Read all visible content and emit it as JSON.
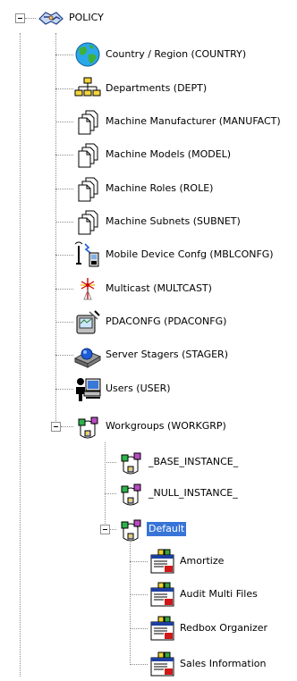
{
  "tree": {
    "root": {
      "label": "POLICY",
      "icon": "handshake-icon",
      "expanded": true
    },
    "items": [
      {
        "label": "Country / Region (COUNTRY)",
        "icon": "globe-icon"
      },
      {
        "label": "Departments (DEPT)",
        "icon": "org-chart-icon"
      },
      {
        "label": "Machine Manufacturer (MANUFACT)",
        "icon": "documents-icon"
      },
      {
        "label": "Machine Models (MODEL)",
        "icon": "documents-icon"
      },
      {
        "label": "Machine Roles (ROLE)",
        "icon": "documents-icon"
      },
      {
        "label": "Machine Subnets (SUBNET)",
        "icon": "documents-icon"
      },
      {
        "label": "Mobile Device Confg (MBLCONFG)",
        "icon": "mobile-device-icon"
      },
      {
        "label": "Multicast (MULTCAST)",
        "icon": "multicast-icon"
      },
      {
        "label": "PDACONFG (PDACONFG)",
        "icon": "pda-icon"
      },
      {
        "label": "Server Stagers (STAGER)",
        "icon": "server-stager-icon"
      },
      {
        "label": "Users (USER)",
        "icon": "user-computer-icon"
      },
      {
        "label": "Workgroups (WORKGRP)",
        "icon": "workgroup-icon",
        "expanded": true
      }
    ],
    "workgroups": [
      {
        "label": "_BASE_INSTANCE_",
        "icon": "workgroup-icon"
      },
      {
        "label": "_NULL_INSTANCE_",
        "icon": "workgroup-icon"
      },
      {
        "label": "Default",
        "icon": "workgroup-icon",
        "expanded": true,
        "selected": true
      }
    ],
    "default_children": [
      {
        "label": "Amortize",
        "icon": "application-window-icon"
      },
      {
        "label": "Audit Multi Files",
        "icon": "application-window-icon"
      },
      {
        "label": "Redbox Organizer",
        "icon": "application-window-icon"
      },
      {
        "label": "Sales Information",
        "icon": "application-window-icon"
      }
    ]
  },
  "colors": {
    "selection": "#3874d8",
    "connector": "#8c8c8c"
  }
}
